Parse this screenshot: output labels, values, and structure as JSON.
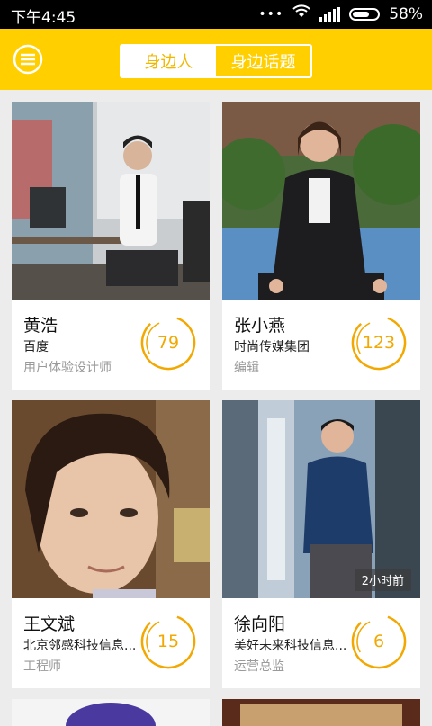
{
  "status_bar": {
    "time": "下午4:45",
    "battery": "58%"
  },
  "header": {
    "tabs": [
      {
        "label": "身边人",
        "active": true
      },
      {
        "label": "身边话题",
        "active": false
      }
    ]
  },
  "colors": {
    "accent": "#ffcf00",
    "score": "#f2a800",
    "text_muted": "#9a9a9a"
  },
  "cards": [
    {
      "name": "黄浩",
      "company": "百度",
      "title": "用户体验设计师",
      "score": "79"
    },
    {
      "name": "张小燕",
      "company": "时尚传媒集团",
      "title": "编辑",
      "score": "123"
    },
    {
      "name": "王文斌",
      "company": "北京邻感科技信息...",
      "title": "工程师",
      "score": "15"
    },
    {
      "name": "徐向阳",
      "company": "美好未来科技信息...",
      "title": "运营总监",
      "score": "6",
      "time_badge": "2小时前"
    }
  ]
}
